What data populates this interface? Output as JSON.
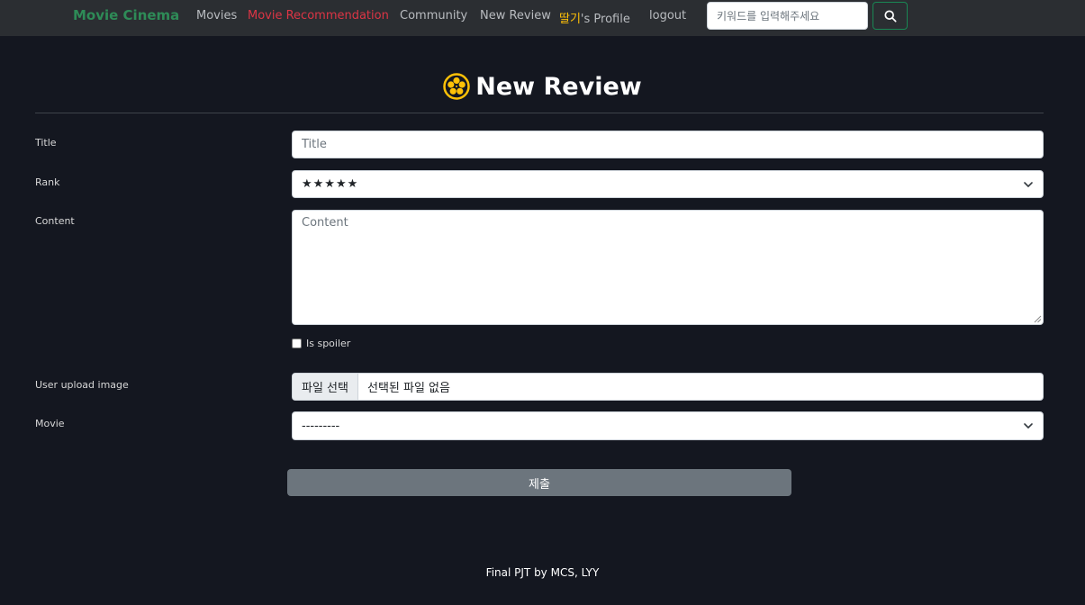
{
  "navbar": {
    "brand": "Movie Cinema",
    "links": {
      "movies": "Movies",
      "recommendation": "Movie Recommendation",
      "community": "Community",
      "new_review": "New Review",
      "profile_user": "딸기",
      "profile_suffix": "'s Profile",
      "logout": "logout"
    },
    "search": {
      "placeholder": "키워드를 입력해주세요",
      "icon": "search-icon"
    }
  },
  "page": {
    "title": "New Review",
    "title_icon": "film-reel-icon"
  },
  "form": {
    "title": {
      "label": "Title",
      "placeholder": "Title",
      "value": ""
    },
    "rank": {
      "label": "Rank",
      "selected": "★★★★★"
    },
    "content": {
      "label": "Content",
      "placeholder": "Content",
      "value": ""
    },
    "spoiler": {
      "label": "Is spoiler",
      "checked": false
    },
    "image": {
      "label": "User upload image",
      "button": "파일 선택",
      "status": "선택된 파일 없음"
    },
    "movie": {
      "label": "Movie",
      "selected": "---------"
    },
    "submit": "제출"
  },
  "footer": {
    "text": "Final PJT by MCS, LYY"
  },
  "colors": {
    "background": "#141720",
    "navbar": "#2b2e32",
    "brand": "#2e8b57",
    "active_link": "#dc3545",
    "username": "#ffc107",
    "submit": "#6c757d"
  }
}
